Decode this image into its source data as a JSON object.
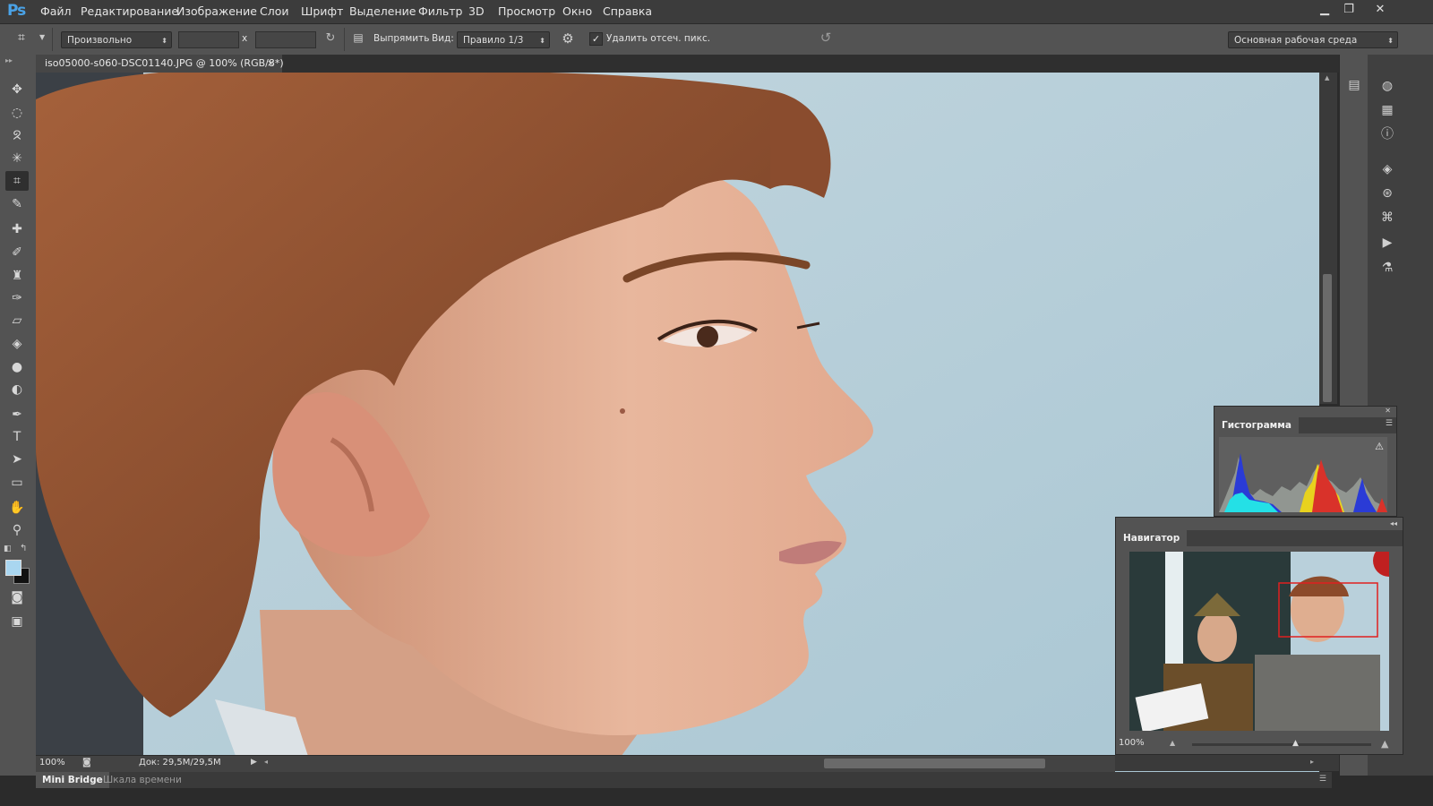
{
  "app": {
    "logo": "Ps"
  },
  "menu": [
    "Файл",
    "Редактирование",
    "Изображение",
    "Слои",
    "Шрифт",
    "Выделение",
    "Фильтр",
    "3D",
    "Просмотр",
    "Окно",
    "Справка"
  ],
  "window_controls": [
    "minimize-icon",
    "restore-icon",
    "close-icon"
  ],
  "options": {
    "ratio_select": "Произвольно",
    "width_value": "",
    "height_value": "",
    "times_sign": "x",
    "straighten_label": "Выпрямить",
    "view_label": "Вид:",
    "view_select": "Правило 1/3",
    "delete_cropped_checked": true,
    "delete_cropped_label": "Удалить отсеч. пикс.",
    "workspace_select": "Основная рабочая среда"
  },
  "document": {
    "tab_title": "iso05000-s060-DSC01140.JPG @ 100% (RGB/8*)",
    "tab_close": "×"
  },
  "status": {
    "zoom": "100%",
    "doc_size": "Док: 29,5M/29,5M"
  },
  "bottom_tabs": [
    "Mini Bridge",
    "Шкала времени"
  ],
  "histogram": {
    "title": "Гистограмма",
    "warning": "⚠"
  },
  "navigator": {
    "title": "Навигатор",
    "zoom": "100%",
    "zoom_level": 0.58
  },
  "colors": {
    "foreground": "#a9d6f0",
    "background": "#111111",
    "accent": "#2f7fd6"
  }
}
